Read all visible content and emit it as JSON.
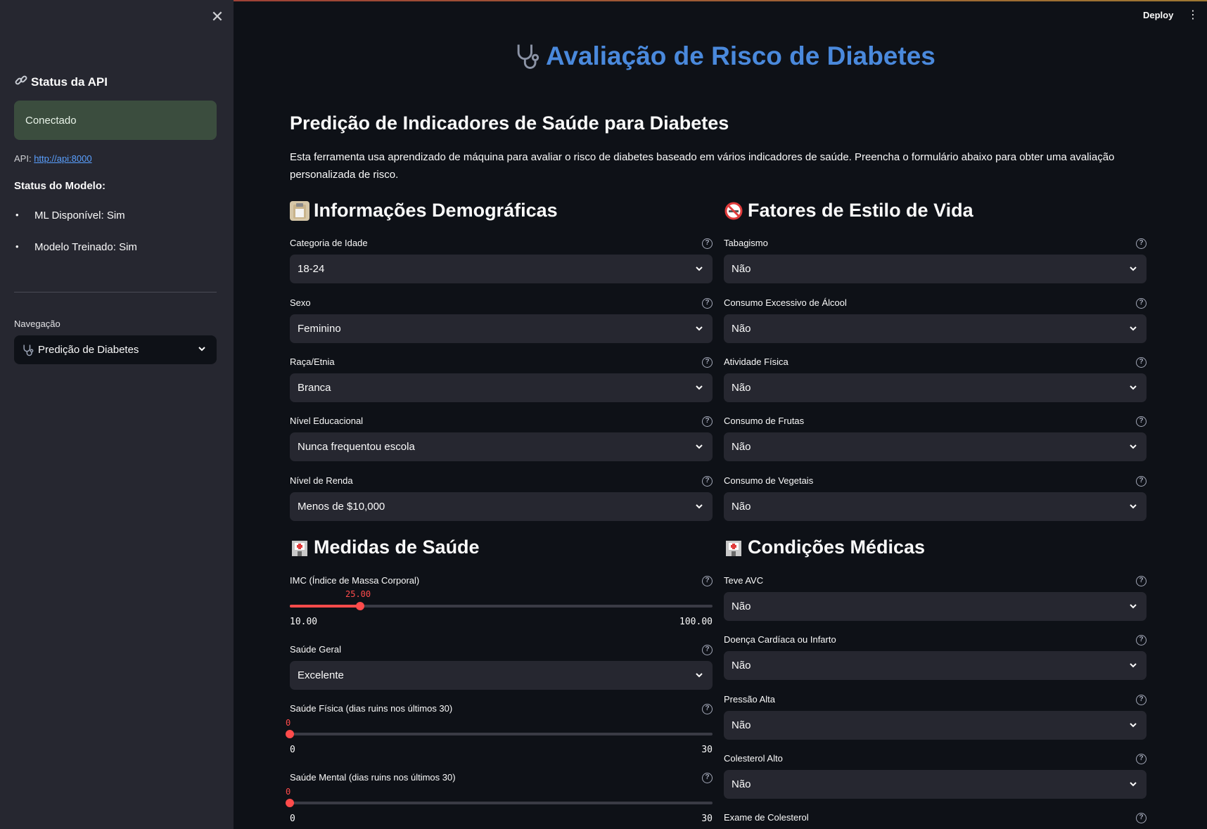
{
  "sidebar": {
    "api_status_title": "Status da API",
    "status_text": "Conectado",
    "api_prefix": "API:",
    "api_url": "http://api:8000",
    "model_status_title": "Status do Modelo:",
    "model_items": [
      "ML Disponível: Sim",
      "Modelo Treinado: Sim"
    ],
    "nav_label": "Navegação",
    "nav_value": "Predição de Diabetes"
  },
  "header": {
    "deploy_label": "Deploy"
  },
  "main": {
    "title": "Avaliação de Risco de Diabetes",
    "subtitle": "Predição de Indicadores de Saúde para Diabetes",
    "intro": "Esta ferramenta usa aprendizado de máquina para avaliar o risco de diabetes baseado em vários indicadores de saúde. Preencha o formulário abaixo para obter uma avaliação personalizada de risco."
  },
  "sections": {
    "demographics": {
      "title": "Informações Demográficas",
      "fields": [
        {
          "label": "Categoria de Idade",
          "value": "18-24"
        },
        {
          "label": "Sexo",
          "value": "Feminino"
        },
        {
          "label": "Raça/Etnia",
          "value": "Branca"
        },
        {
          "label": "Nível Educacional",
          "value": "Nunca frequentou escola"
        },
        {
          "label": "Nível de Renda",
          "value": "Menos de $10,000"
        }
      ]
    },
    "lifestyle": {
      "title": "Fatores de Estilo de Vida",
      "fields": [
        {
          "label": "Tabagismo",
          "value": "Não"
        },
        {
          "label": "Consumo Excessivo de Álcool",
          "value": "Não"
        },
        {
          "label": "Atividade Física",
          "value": "Não"
        },
        {
          "label": "Consumo de Frutas",
          "value": "Não"
        },
        {
          "label": "Consumo de Vegetais",
          "value": "Não"
        }
      ]
    },
    "health": {
      "title": "Medidas de Saúde",
      "bmi": {
        "label": "IMC (Índice de Massa Corporal)",
        "value": "25.00",
        "min": "10.00",
        "max": "100.00",
        "fraction": 0.1667
      },
      "general_health": {
        "label": "Saúde Geral",
        "value": "Excelente"
      },
      "physical_health": {
        "label": "Saúde Física (dias ruins nos últimos 30)",
        "value": "0",
        "min": "0",
        "max": "30",
        "fraction": 0
      },
      "mental_health": {
        "label": "Saúde Mental (dias ruins nos últimos 30)",
        "value": "0",
        "min": "0",
        "max": "30",
        "fraction": 0
      }
    },
    "medical": {
      "title": "Condições Médicas",
      "fields": [
        {
          "label": "Teve AVC",
          "value": "Não"
        },
        {
          "label": "Doença Cardíaca ou Infarto",
          "value": "Não"
        },
        {
          "label": "Pressão Alta",
          "value": "Não"
        },
        {
          "label": "Colesterol Alto",
          "value": "Não"
        }
      ],
      "last_label": "Exame de Colesterol"
    }
  },
  "colors": {
    "accent": "#ff4b4b",
    "title_blue": "#4a89dc",
    "sidebar_bg": "#262730",
    "status_bg": "#3b4d3e"
  },
  "icons": {
    "api": "link-icon",
    "title": "stethoscope-icon",
    "demographics": "clipboard-icon",
    "lifestyle": "no-smoking-icon",
    "health": "hospital-icon",
    "medical": "hospital-icon",
    "help": "help-circle-icon",
    "chevron": "chevron-down-icon",
    "close": "close-icon",
    "menu": "kebab-menu-icon"
  }
}
